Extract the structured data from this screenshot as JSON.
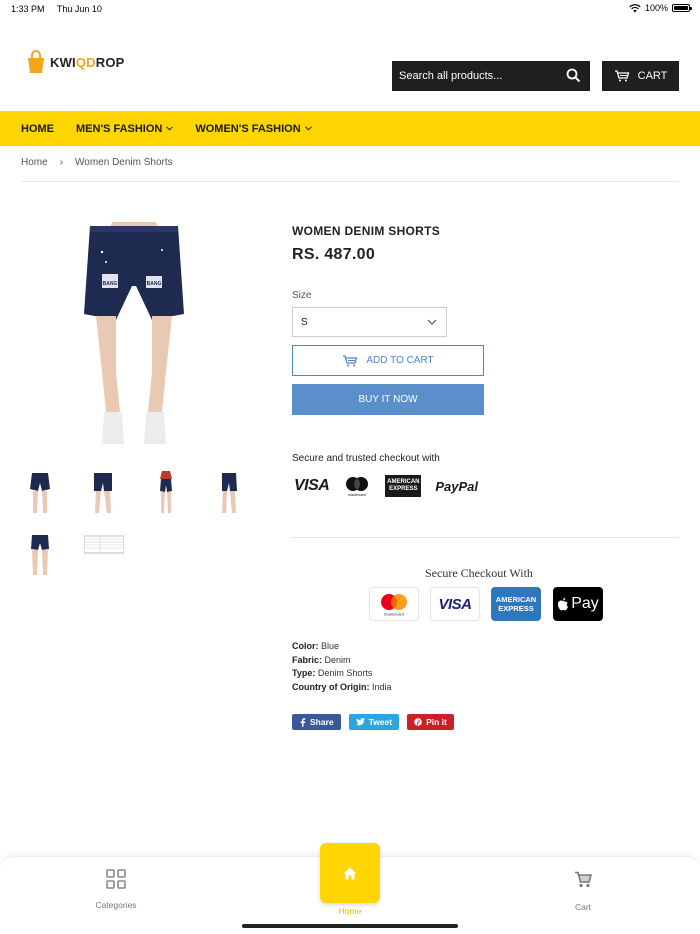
{
  "status_bar": {
    "time": "1:33 PM",
    "date": "Thu Jun 10",
    "battery": "100%"
  },
  "header": {
    "logo_prefix": "KWI",
    "logo_accent": "QD",
    "logo_suffix": "ROP",
    "search_placeholder": "Search all products...",
    "cart_label": "CART"
  },
  "nav": {
    "items": [
      {
        "label": "HOME",
        "dropdown": false
      },
      {
        "label": "MEN'S FASHION",
        "dropdown": true
      },
      {
        "label": "WOMEN'S FASHION",
        "dropdown": true
      }
    ]
  },
  "breadcrumb": {
    "home": "Home",
    "separator": "›",
    "current": "Women Denim Shorts"
  },
  "product": {
    "title": "WOMEN DENIM SHORTS",
    "price": "RS. 487.00",
    "size_label": "Size",
    "size_value": "S",
    "add_to_cart": "ADD TO CART",
    "buy_now": "BUY IT NOW",
    "secure_text": "Secure and trusted checkout with",
    "payment_logos": {
      "visa": "VISA",
      "mastercard": "mastercard",
      "amex": "AMERICAN EXPRESS",
      "paypal": "PayPal"
    },
    "checkout_heading": "Secure Checkout With",
    "checkout_badges": {
      "mastercard": "mastercard",
      "visa": "VISA",
      "amex_line1": "AMERICAN",
      "amex_line2": "EXPRESS",
      "applepay": "Pay"
    },
    "specs": [
      {
        "key": "Color:",
        "value": "Blue"
      },
      {
        "key": "Fabric:",
        "value": "Denim"
      },
      {
        "key": "Type:",
        "value": "Denim Shorts"
      },
      {
        "key": "Country of Origin:",
        "value": "India"
      }
    ],
    "shirt_print": "BANG"
  },
  "share": {
    "facebook": "Share",
    "twitter": "Tweet",
    "pinterest": "Pin it"
  },
  "bottom_nav": {
    "categories": "Categories",
    "home": "Home",
    "cart": "Cart"
  },
  "colors": {
    "accent_yellow": "#ffd500",
    "button_blue": "#5b8fcc",
    "dark": "#1f1f1f",
    "facebook": "#3b5998",
    "twitter": "#2ba6e1",
    "pinterest": "#cb2027"
  },
  "icons": [
    "wifi-icon",
    "battery-icon",
    "shopping-bag-logo-icon",
    "search-icon",
    "cart-icon",
    "chevron-down-icon",
    "facebook-icon",
    "twitter-icon",
    "pinterest-icon",
    "grid-icon",
    "home-icon",
    "cart-icon"
  ]
}
